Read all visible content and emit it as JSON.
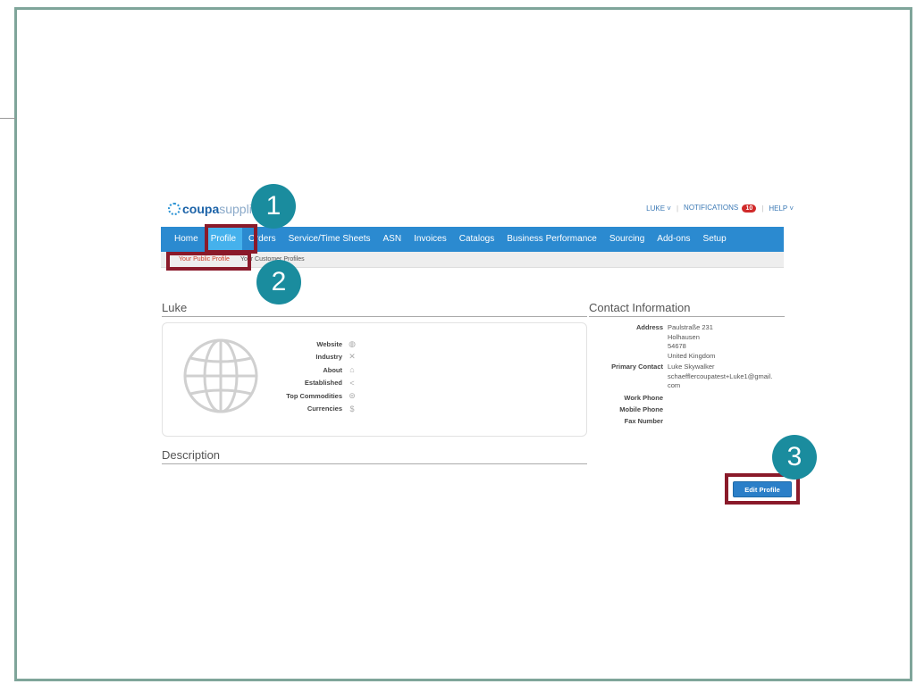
{
  "header": {
    "logo_brand": "coupa",
    "logo_rest": " suppli",
    "user_menu": "LUKE ˅",
    "notifications_label": "NOTIFICATIONS",
    "notifications_count": "10",
    "help_menu": "HELP ˅"
  },
  "nav": {
    "items": [
      {
        "label": "Home"
      },
      {
        "label": "Profile"
      },
      {
        "label": "Orders"
      },
      {
        "label": "Service/Time Sheets"
      },
      {
        "label": "ASN"
      },
      {
        "label": "Invoices"
      },
      {
        "label": "Catalogs"
      },
      {
        "label": "Business Performance"
      },
      {
        "label": "Sourcing"
      },
      {
        "label": "Add-ons"
      },
      {
        "label": "Setup"
      }
    ],
    "active": "Profile"
  },
  "subnav": {
    "items": [
      {
        "label": "Your Public Profile"
      },
      {
        "label": "Your Customer Profiles"
      }
    ]
  },
  "profile": {
    "name": "Luke",
    "fields": [
      {
        "label": "Website",
        "icon": "globe-icon"
      },
      {
        "label": "Industry",
        "icon": "tools-icon"
      },
      {
        "label": "About",
        "icon": "home-icon"
      },
      {
        "label": "Established",
        "icon": "branch-icon"
      },
      {
        "label": "Top Commodities",
        "icon": "box-icon"
      },
      {
        "label": "Currencies",
        "icon": "dollar-icon"
      }
    ]
  },
  "contact": {
    "title": "Contact Information",
    "address_label": "Address",
    "address_lines": [
      "Paulstraße 231",
      "Holhausen",
      "54678",
      "United Kingdom"
    ],
    "primary_contact_label": "Primary Contact",
    "primary_contact_lines": [
      "Luke Skywalker",
      "schaefflercoupatest+Luke1@gmail.",
      "com"
    ],
    "work_phone_label": "Work Phone",
    "mobile_phone_label": "Mobile Phone",
    "fax_number_label": "Fax Number"
  },
  "description": {
    "title": "Description"
  },
  "actions": {
    "edit_profile": "Edit Profile"
  },
  "callouts": {
    "one": "1",
    "two": "2",
    "three": "3"
  },
  "colors": {
    "nav_bg": "#2b8ad0",
    "nav_active": "#45b1ec",
    "callout": "#1a8c9e",
    "highlight": "#8a1a2a",
    "button": "#2b7fc8"
  }
}
